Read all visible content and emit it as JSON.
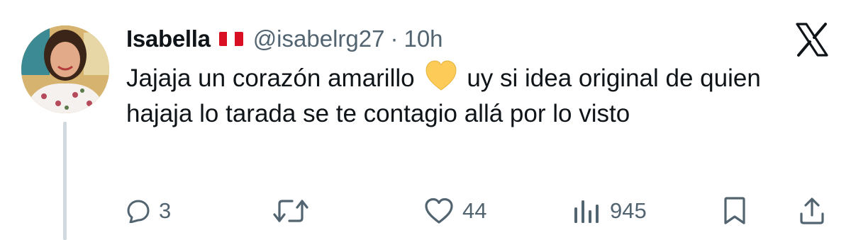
{
  "tweet": {
    "author": {
      "name": "Isabella",
      "flag_icon": "peru-flag-icon",
      "handle": "@isabelrg27",
      "separator": "·",
      "time": "10h"
    },
    "text_before_emoji": "Jajaja un corazón amarillo",
    "emoji_icon": "yellow-heart-icon",
    "text_after_emoji": "uy si idea original de quien hajaja lo tarada se te contagio allá por lo visto"
  },
  "actions": {
    "reply": {
      "icon": "reply-icon",
      "count": "3"
    },
    "retweet": {
      "icon": "retweet-icon",
      "count": ""
    },
    "like": {
      "icon": "heart-icon",
      "count": "44"
    },
    "views": {
      "icon": "views-icon",
      "count": "945"
    },
    "bookmark": {
      "icon": "bookmark-icon"
    },
    "share": {
      "icon": "share-icon"
    }
  },
  "colors": {
    "text": "#0f1419",
    "secondary": "#536471",
    "thread_line": "#cfd9de",
    "flag_red": "#d91023",
    "heart_yellow": "#fdcb58"
  }
}
